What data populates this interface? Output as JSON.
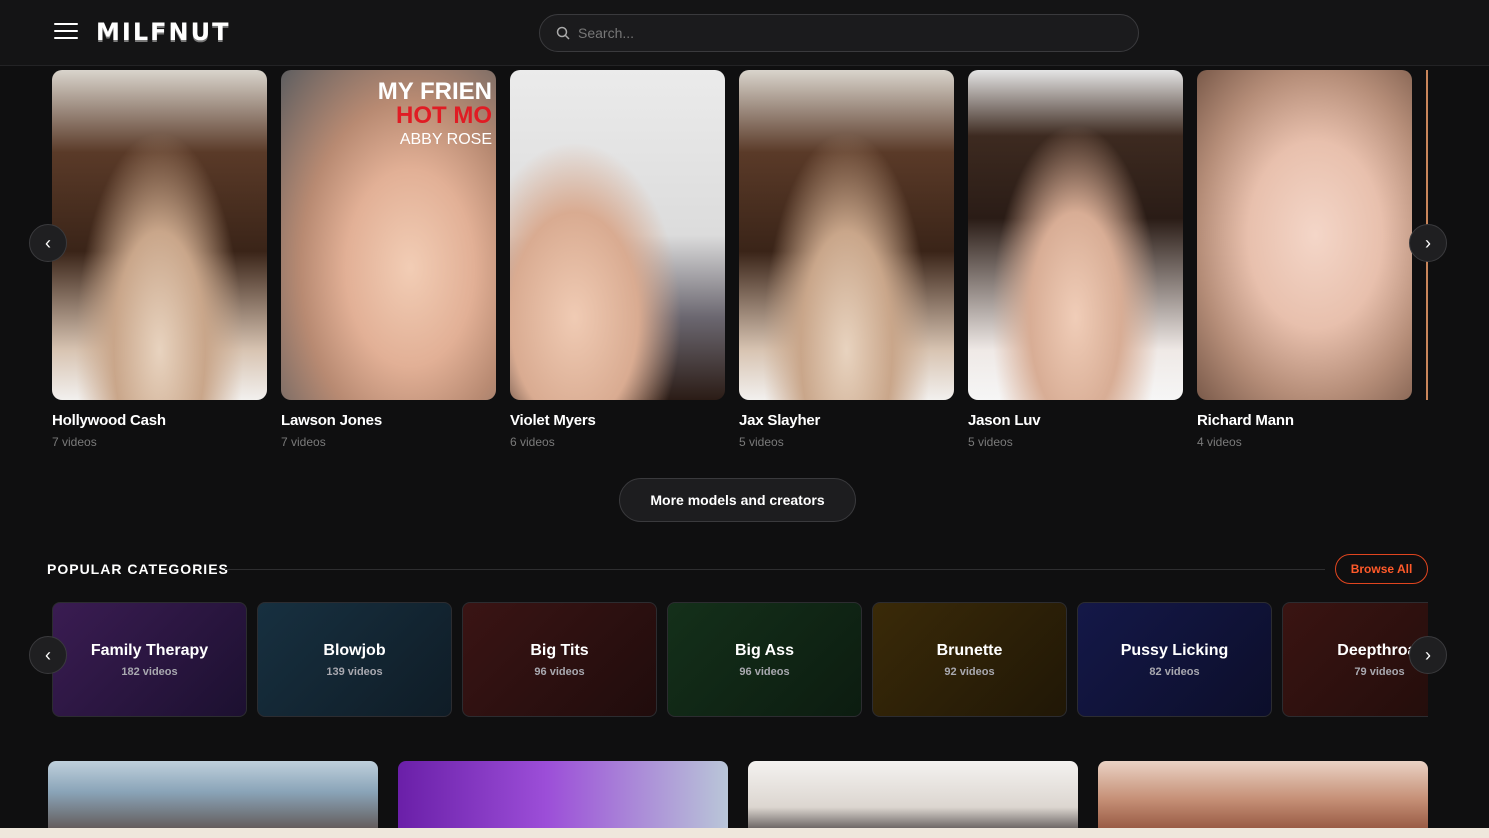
{
  "header": {
    "logo": "MILFNUT",
    "search_placeholder": "Search..."
  },
  "models": [
    {
      "name": "Hollywood Cash",
      "count": "7 videos"
    },
    {
      "name": "Lawson Jones",
      "count": "7 videos"
    },
    {
      "name": "Violet Myers",
      "count": "6 videos"
    },
    {
      "name": "Jax Slayher",
      "count": "5 videos"
    },
    {
      "name": "Jason Luv",
      "count": "5 videos"
    },
    {
      "name": "Richard Mann",
      "count": "4 videos"
    }
  ],
  "thumb_overlay": {
    "line1": "MY FRIEN",
    "line2": "HOT MO",
    "line3": "ABBY ROSE"
  },
  "more_button": "More models and creators",
  "categories_section": {
    "title": "POPULAR CATEGORIES",
    "browse_label": "Browse All",
    "items": [
      {
        "name": "Family Therapy",
        "count": "182 videos"
      },
      {
        "name": "Blowjob",
        "count": "139 videos"
      },
      {
        "name": "Big Tits",
        "count": "96 videos"
      },
      {
        "name": "Big Ass",
        "count": "96 videos"
      },
      {
        "name": "Brunette",
        "count": "92 videos"
      },
      {
        "name": "Pussy Licking",
        "count": "82 videos"
      },
      {
        "name": "Deepthroat",
        "count": "79 videos"
      }
    ]
  },
  "icons": {
    "prev": "chevron-left-icon",
    "next": "chevron-right-icon",
    "menu": "hamburger-icon",
    "search": "search-icon"
  },
  "colors": {
    "background": "#0f0f10",
    "accent": "#ff5a2a"
  }
}
